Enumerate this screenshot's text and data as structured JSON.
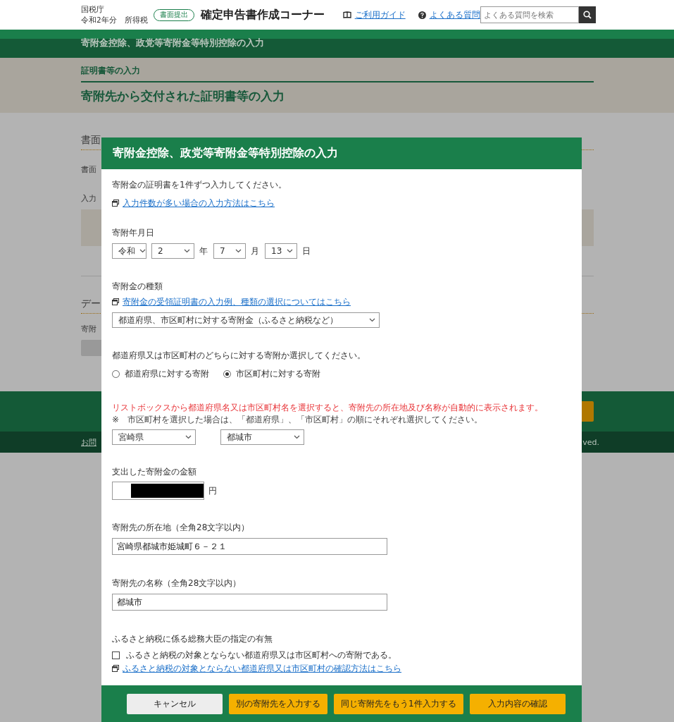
{
  "header": {
    "agency": "国税庁",
    "year_line": "令和2年分　所得税",
    "badge": "書面提出",
    "title": "確定申告書作成コーナー",
    "links": [
      {
        "kind": "guide",
        "label": "ご利用ガイド"
      },
      {
        "kind": "faq",
        "label": "よくある質問"
      }
    ],
    "search": {
      "placeholder": "よくある質問を検索"
    }
  },
  "page": {
    "section_title": "寄附金控除、政党等寄附金等特別控除の入力",
    "breadcrumb": "証明書等の入力",
    "heading": "寄附先から交付された証明書等の入力",
    "section_1_heading": "書面",
    "section_1_text": "書面",
    "section_1_label": "入力",
    "section_2_heading": "デー",
    "section_2_label": "寄附",
    "footer_link": "お問",
    "copyright": "ved."
  },
  "dialog": {
    "title": "寄附金控除、政党等寄附金等特別控除の入力",
    "intro": "寄附金の証明書を1件ずつ入力してください。",
    "bulk_link": "入力件数が多い場合の入力方法はこちら",
    "date_label": "寄附年月日",
    "date_parts": [
      {
        "value": "令和"
      },
      {
        "value": "2",
        "unit": "年"
      },
      {
        "value": "7",
        "unit": "月"
      },
      {
        "value": "13",
        "unit": "日"
      }
    ],
    "type_label": "寄附金の種類",
    "type_link": "寄附金の受領証明書の入力例、種類の選択についてはこちら",
    "type_value": "都道府県、市区町村に対する寄附金（ふるさと納税など）",
    "target_question": "都道府県又は市区町村のどちらに対する寄附か選択してください。",
    "target_options": [
      {
        "label": "都道府県に対する寄附",
        "selected": false
      },
      {
        "label": "市区町村に対する寄附",
        "selected": true
      }
    ],
    "auto_notice": "リストボックスから都道府県名又は市区町村名を選択すると、寄附先の所在地及び名称が自動的に表示されます。",
    "auto_note": "※　市区町村を選択した場合は、「都道府県」、「市区町村」の順にそれぞれ選択してください。",
    "prefecture": "宮崎県",
    "municipality": "都城市",
    "amount_label": "支出した寄附金の金額",
    "amount_unit": "円",
    "address_label": "寄附先の所在地（全角28文字以内）",
    "address_value": "宮崎県都城市姫城町６－２１",
    "name_label": "寄附先の名称（全角28文字以内）",
    "name_value": "都城市",
    "designation_label": "ふるさと納税に係る総務大臣の指定の有無",
    "designation_checkbox": {
      "label": "ふるさと納税の対象とならない都道府県又は市区町村への寄附である。",
      "checked": false
    },
    "designation_link": "ふるさと納税の対象とならない都道府県又は市区町村の確認方法はこちら",
    "buttons": [
      {
        "kind": "secondary",
        "label": "キャンセル"
      },
      {
        "kind": "primary",
        "label": "別の寄附先を入力する"
      },
      {
        "kind": "primary",
        "label": "同じ寄附先をもう1件入力する"
      },
      {
        "kind": "primary",
        "label": "入力内容の確認"
      }
    ]
  }
}
